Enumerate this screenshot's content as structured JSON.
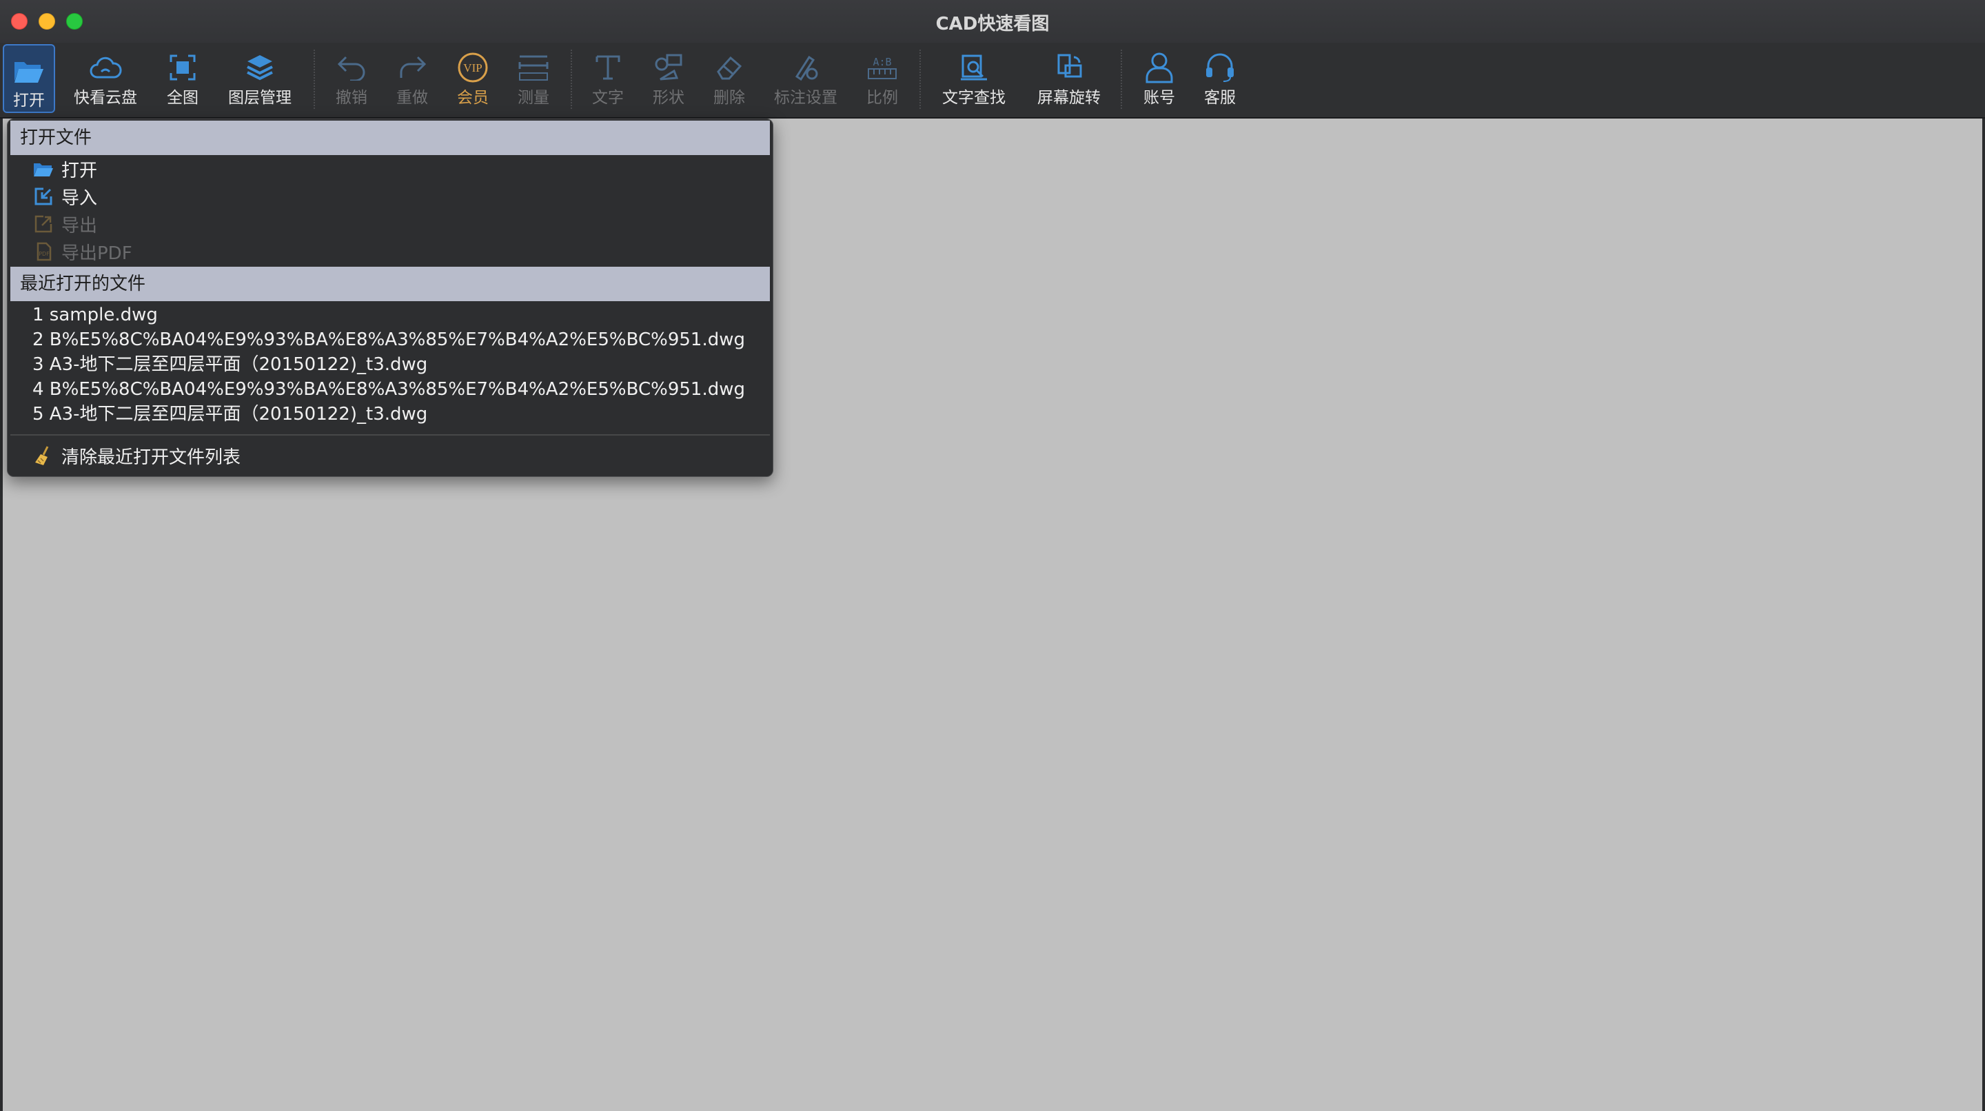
{
  "window": {
    "title": "CAD快速看图"
  },
  "colors": {
    "accent": "#3d8fd8",
    "vip": "#d9a04a",
    "disabled": "#6d6e70",
    "canvas": "#c0c0c0",
    "section": "#b8bccb"
  },
  "toolbar": {
    "open": "打开",
    "cloud": "快看云盘",
    "fullview": "全图",
    "layers": "图层管理",
    "undo": "撤销",
    "redo": "重做",
    "vip": "会员",
    "measure": "测量",
    "text": "文字",
    "shape": "形状",
    "delete": "删除",
    "annotation_settings": "标注设置",
    "scale": "比例",
    "text_search": "文字查找",
    "rotate_screen": "屏幕旋转",
    "account": "账号",
    "support": "客服"
  },
  "menu": {
    "open_section": "打开文件",
    "items": [
      {
        "label": "打开",
        "icon": "folder-open-icon",
        "enabled": true
      },
      {
        "label": "导入",
        "icon": "import-icon",
        "enabled": true
      },
      {
        "label": "导出",
        "icon": "export-icon",
        "enabled": false
      },
      {
        "label": "导出PDF",
        "icon": "pdf-icon",
        "enabled": false
      }
    ],
    "recent_section": "最近打开的文件",
    "recent": [
      "1 sample.dwg",
      "2 B%E5%8C%BA04%E9%93%BA%E8%A3%85%E7%B4%A2%E5%BC%951.dwg",
      "3 A3-地下二层至四层平面（20150122)_t3.dwg",
      "4 B%E5%8C%BA04%E9%93%BA%E8%A3%85%E7%B4%A2%E5%BC%951.dwg",
      "5 A3-地下二层至四层平面（20150122)_t3.dwg"
    ],
    "clear_recent": "清除最近打开文件列表"
  }
}
